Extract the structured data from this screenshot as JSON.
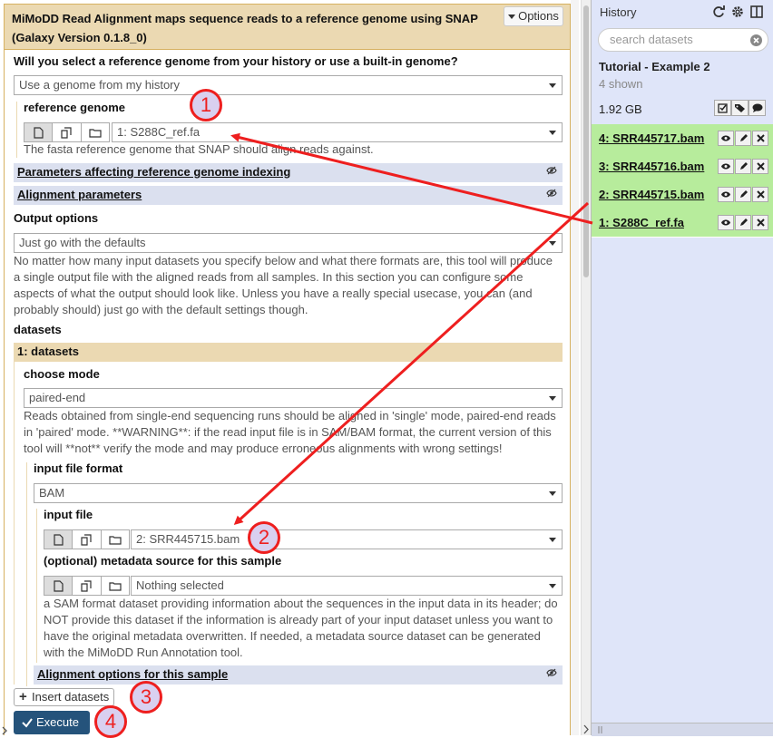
{
  "tool": {
    "title_line1": "MiMoDD Read Alignment maps sequence reads to a reference genome using SNAP",
    "title_line2": "(Galaxy Version 0.1.8_0)",
    "options_label": "Options",
    "genome_question": "Will you select a reference genome from your history or use a built-in genome?",
    "genome_source_value": "Use a genome from my history",
    "reference_genome_label": "reference genome",
    "reference_genome_value": "1: S288C_ref.fa",
    "reference_genome_help": "The fasta reference genome that SNAP should align reads against.",
    "section_indexing": "Parameters affecting reference genome indexing",
    "section_alignment": "Alignment parameters",
    "output_options_label": "Output options",
    "output_options_value": "Just go with the defaults",
    "output_help_lines": [
      "No matter how many input datasets you specify below and what there formats are, this tool will produce",
      "a single output file with the aligned reads from all samples. In this section you can configure some",
      "aspects of what the output should look like. Unless you have a really special usecase, you can (and",
      "probably should) just go with the default settings though."
    ],
    "datasets_label": "datasets",
    "repeat_title": "1: datasets",
    "choose_mode_label": "choose mode",
    "choose_mode_value": "paired-end",
    "mode_help_lines": [
      "Reads obtained from single-end sequencing runs should be aligned in 'single' mode, paired-end reads",
      "in 'paired' mode. **WARNING**: if the read input file is in SAM/BAM format, the current version of this",
      "tool will **not** verify the mode and may produce erroneous alignments with wrong settings!"
    ],
    "input_format_label": "input file format",
    "input_format_value": "BAM",
    "input_file_label": "input file",
    "input_file_value": "2: SRR445715.bam",
    "metadata_label": "(optional) metadata source for this sample",
    "metadata_value": "Nothing selected",
    "metadata_help_lines": [
      "a SAM format dataset providing information about the sequences in the input data in its header; do",
      "NOT provide this dataset if the information is already part of your input dataset unless you want to",
      "have the original metadata overwritten. If needed, a metadata source dataset can be generated",
      "with the MiMoDD Run Annotation tool."
    ],
    "section_sample_options": "Alignment options for this sample",
    "insert_label": "Insert datasets",
    "execute_label": "Execute"
  },
  "history": {
    "title": "History",
    "search_placeholder": "search datasets",
    "name": "Tutorial - Example 2",
    "shown": "4 shown",
    "size": "1.92 GB",
    "items": [
      {
        "label": "4: SRR445717.bam"
      },
      {
        "label": "3: SRR445716.bam"
      },
      {
        "label": "2: SRR445715.bam"
      },
      {
        "label": "1: S288C_ref.fa"
      }
    ]
  },
  "annotations": [
    "1",
    "2",
    "3",
    "4"
  ],
  "colors": {
    "accent_tan": "#ebd9b2",
    "section_blue": "#dbe0ef",
    "history_bg": "#dfe5f9",
    "dataset_ok": "#b7ec9c",
    "execute_bg": "#25537b",
    "annotation_red": "#ee1f1f"
  }
}
